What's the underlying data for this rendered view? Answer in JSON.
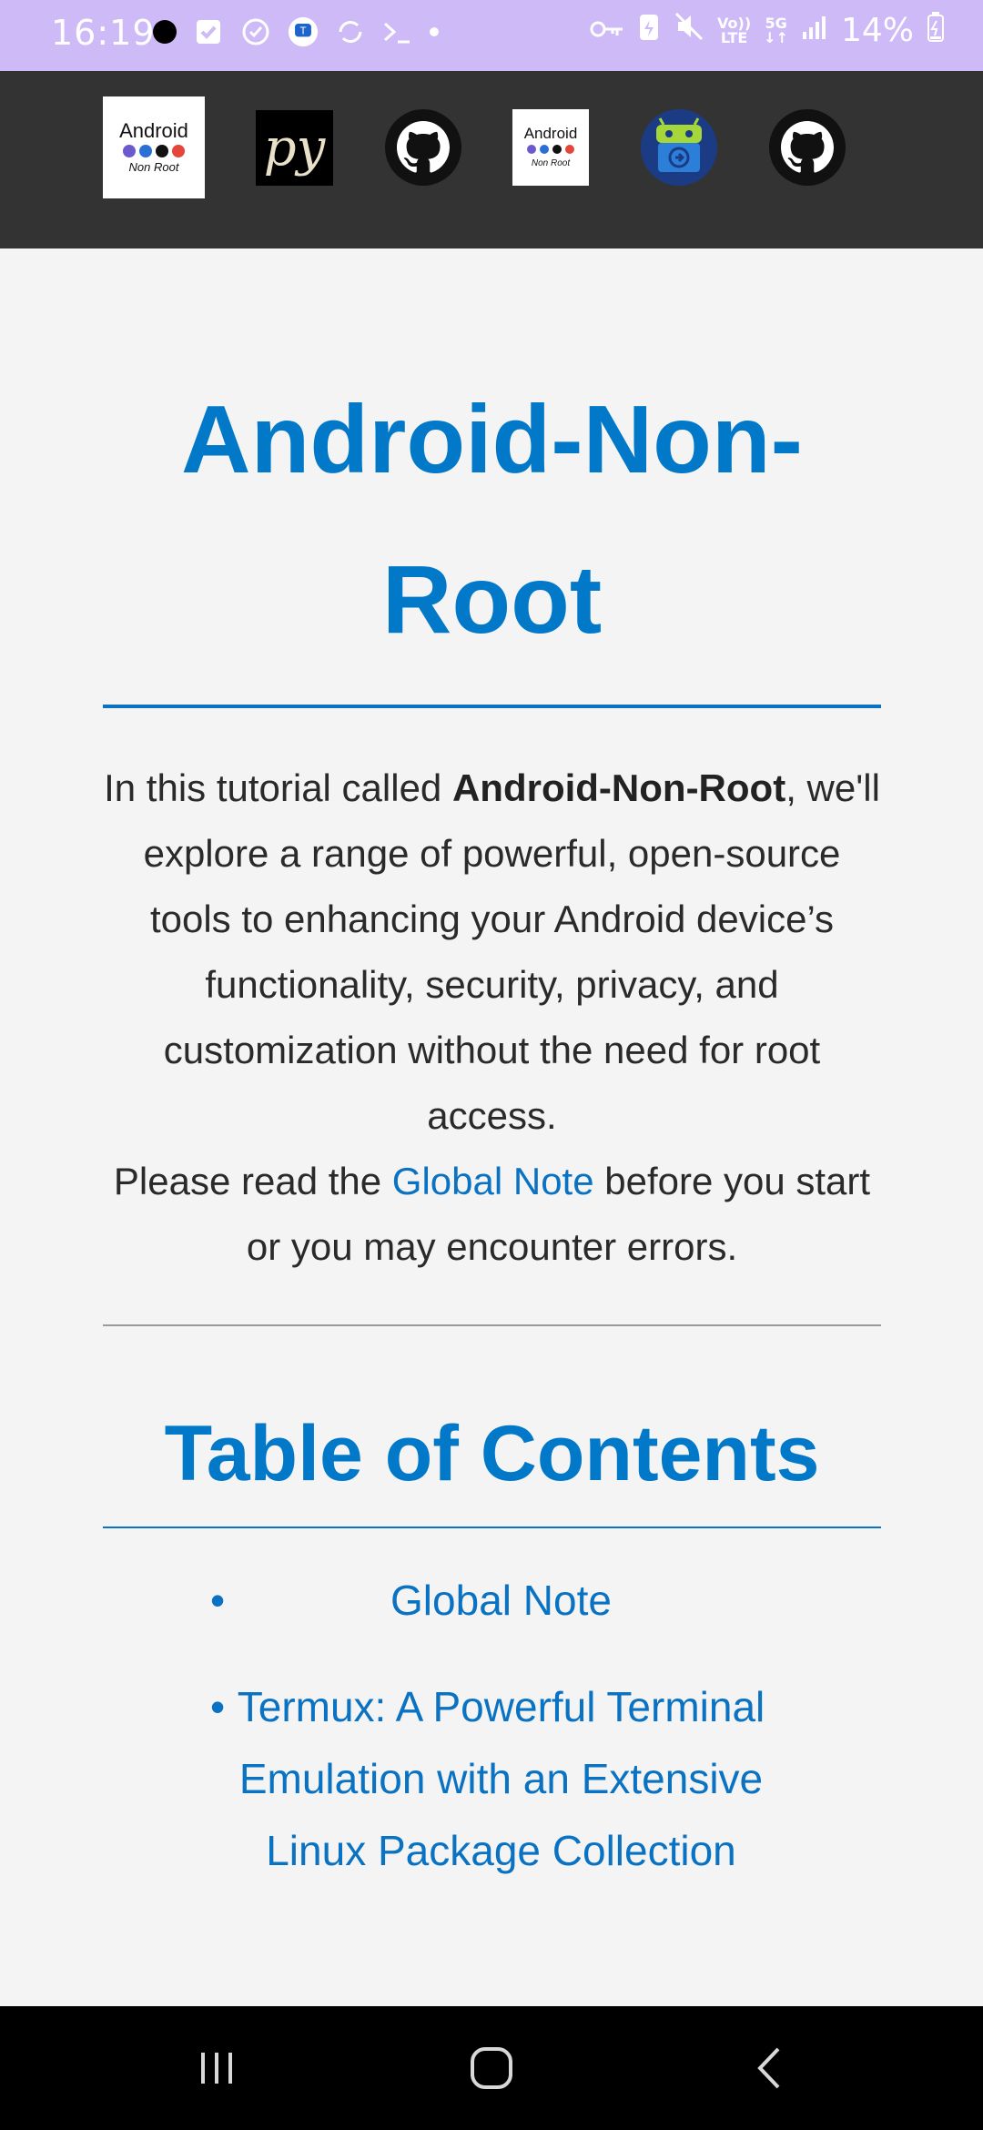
{
  "status_bar": {
    "time": "16:19",
    "battery": "14%",
    "network": "5G",
    "volte": "LTE",
    "volte_top": "Vo))"
  },
  "header_icons": [
    {
      "name": "android-non-root-logo",
      "line1": "Android",
      "line2": "Non Root"
    },
    {
      "name": "py-logo",
      "text": "py"
    },
    {
      "name": "github-icon"
    },
    {
      "name": "android-non-root-logo-small",
      "line1": "Android",
      "line2": "Non Root"
    },
    {
      "name": "android-app-icon"
    },
    {
      "name": "github-icon-2"
    }
  ],
  "page": {
    "title": "Android-Non-Root",
    "intro_before": "In this tutorial called ",
    "intro_bold": "Android-Non-Root",
    "intro_after": ", we'll explore a range of powerful, open-source tools to enhancing your Android device’s functionality, security, privacy, and customization without the need for root access.",
    "note_before": "Please read the ",
    "note_link": "Global Note",
    "note_after": " before you start or you may encounter errors.",
    "toc_title": "Table of Contents",
    "toc_items": [
      "Global Note",
      "Termux: A Powerful Terminal Emulation with an Extensive Linux Package Collection"
    ]
  },
  "colors": {
    "accent": "#0278c9",
    "status_bar_bg": "#cdbaf7",
    "header_bg": "#333333",
    "page_bg": "#f4f4f4"
  }
}
